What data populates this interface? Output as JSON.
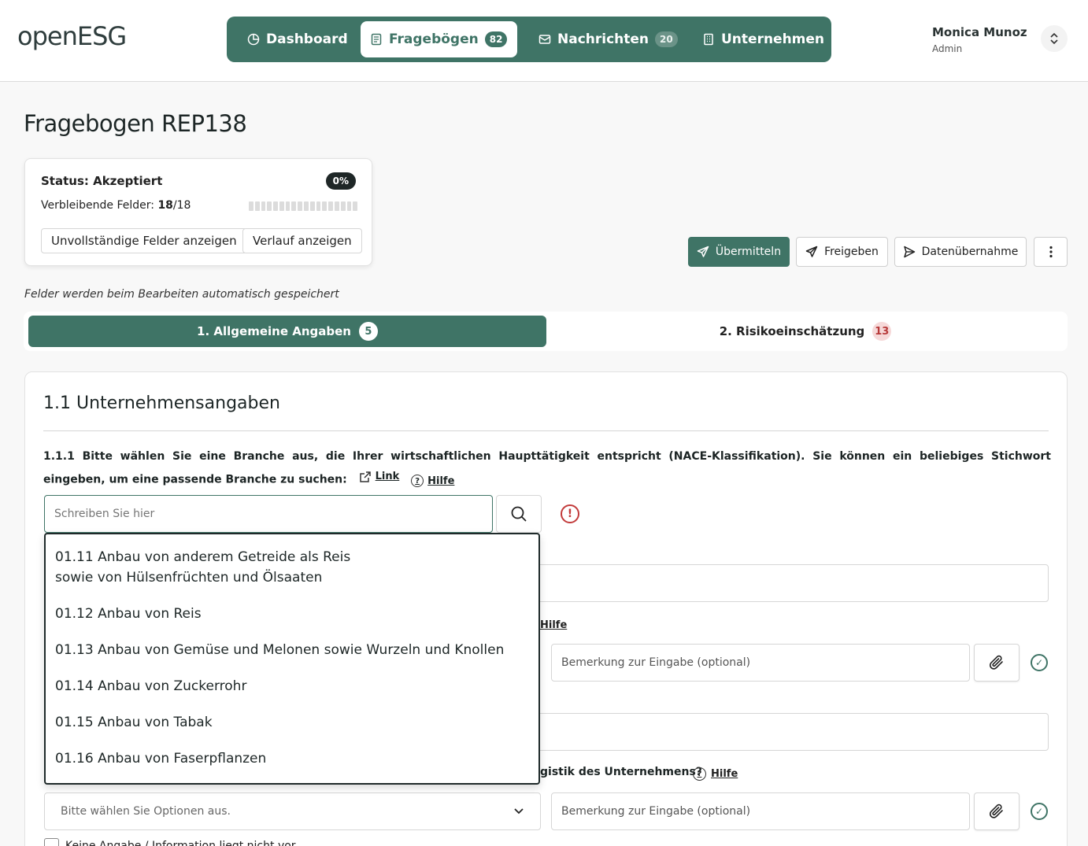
{
  "header": {
    "logo": "openESG",
    "nav": [
      {
        "label": "Dashboard",
        "badge": "",
        "active": false
      },
      {
        "label": "Fragebögen",
        "badge": "82",
        "active": true
      },
      {
        "label": "Nachrichten",
        "badge": "20",
        "active": false
      },
      {
        "label": "Unternehmen",
        "badge": "",
        "active": false
      }
    ],
    "user": {
      "name": "Monica Munoz",
      "role": "Admin"
    }
  },
  "page": {
    "title": "Fragebogen REP138"
  },
  "status": {
    "label": "Status: Akzeptiert",
    "percent": "0%",
    "remaining_label": "Verbleibende Felder:",
    "remaining_done": "18",
    "remaining_total": "/18",
    "progress_fraction": 0,
    "show_incomplete": "Unvollständige Felder anzeigen",
    "show_history": "Verlauf anzeigen"
  },
  "actions": {
    "submit": "Übermitteln",
    "share": "Freigeben",
    "import": "Datenübernahme"
  },
  "autosave_note": "Felder werden beim Bearbeiten automatisch gespeichert",
  "tabs": [
    {
      "label": "1.  Allgemeine Angaben",
      "count": "5"
    },
    {
      "label": "2.  Risikoeinschätzung",
      "count": "13"
    }
  ],
  "section": {
    "title": "1.1 Unternehmensangaben",
    "question_1": "1.1.1 Bitte wählen Sie eine Branche aus, die Ihrer wirtschaftlichen Haupttätigkeit entspricht (NACE-Klassifikation). Sie können ein beliebiges Stichwort eingeben, um eine passende Branche zu suchen:",
    "link_label": "Link",
    "help_label": "Hilfe",
    "search_placeholder": "Schreiben Sie hier",
    "hidden_help_fragment": "Hilfe",
    "question_partial": "gistik des Unternehmens?",
    "help_label_2": "Hilfe",
    "remark_placeholder": "Bemerkung zur Eingabe (optional)",
    "select_placeholder": "Bitte wählen Sie Optionen aus.",
    "no_info_label": "Keine Angabe / Information liegt nicht vor"
  },
  "dropdown": {
    "items": [
      {
        "line1": "01.11 Anbau von anderem Getreide als Reis",
        "line2": "sowie von Hülsenfrüchten und Ölsaaten"
      },
      {
        "line1": "01.12 Anbau von Reis"
      },
      {
        "line1": "01.13 Anbau von Gemüse und Melonen sowie Wurzeln und Knollen"
      },
      {
        "line1": "01.14 Anbau von Zuckerrohr"
      },
      {
        "line1": "01.15 Anbau von Tabak"
      },
      {
        "line1": "01.16 Anbau von Faserpflanzen"
      }
    ]
  },
  "colors": {
    "accent": "#3f7466",
    "error": "#c23a3a",
    "badge_red_bg": "#f6d9d9"
  }
}
